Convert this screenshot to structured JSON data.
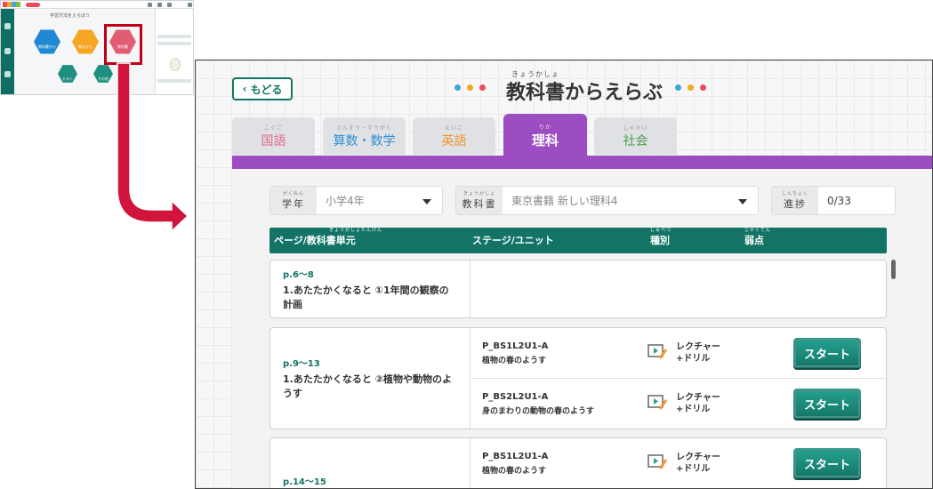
{
  "thumbnail": {
    "title": "学習方法をえらぼう",
    "hexes": [
      {
        "label": "教科書から",
        "color": "#1e88d4"
      },
      {
        "label": "単元から",
        "color": "#f5a623"
      },
      {
        "label": "教科書",
        "color": "#e25c74"
      },
      {
        "label": "テスト",
        "color": "#1f8f80"
      },
      {
        "label": "その他",
        "color": "#1f8f80"
      }
    ]
  },
  "colors": {
    "accent": "#137466",
    "science": "#9b4dc1",
    "arrow": "#d0143c"
  },
  "header": {
    "back_label": "もどる",
    "title_ruby": "きょうかしょ",
    "title": "教科書からえらぶ"
  },
  "tabs": [
    {
      "ruby": "こくご",
      "label": "国語",
      "color": "#e56a87",
      "active": false
    },
    {
      "ruby": "さんすう・すうがく",
      "label": "算数・数学",
      "color": "#2e8fd3",
      "active": false
    },
    {
      "ruby": "えいご",
      "label": "英語",
      "color": "#f0962b",
      "active": false
    },
    {
      "ruby": "りか",
      "label": "理科",
      "color": "#ffffff",
      "active": true
    },
    {
      "ruby": "しゃかい",
      "label": "社会",
      "color": "#4aa04a",
      "active": false
    }
  ],
  "filters": {
    "grade": {
      "ruby": "がくねん",
      "label": "学年",
      "value": "小学4年"
    },
    "textbook": {
      "ruby": "きょうかしょ",
      "label": "教科書",
      "value": "東京書籍 新しい理科4"
    },
    "progress": {
      "ruby": "しんちょく",
      "label": "進捗",
      "value": "0/33"
    }
  },
  "table": {
    "headers": {
      "page_ruby": "きょうかしょたんげん",
      "page": "ページ/教科書単元",
      "stage": "ステージ/ユニット",
      "kind_ruby": "しゅべつ",
      "kind": "種別",
      "weak_ruby": "じゃくてん",
      "weak": "弱点"
    },
    "rows": [
      {
        "page": "p.6〜8",
        "unit": "1.あたたかくなると ①1年間の観察の計画",
        "stages": []
      },
      {
        "page": "p.9〜13",
        "unit": "1.あたたかくなると ②植物や動物のようす",
        "stages": [
          {
            "code": "P_BS1L2U1-A",
            "name": "植物の春のようす",
            "kind1": "レクチャー",
            "kind2": "+ドリル",
            "button": "スタート"
          },
          {
            "code": "P_BS2L2U1-A",
            "name": "身のまわりの動物の春のようす",
            "kind1": "レクチャー",
            "kind2": "+ドリル",
            "button": "スタート"
          }
        ]
      },
      {
        "page": "p.14〜15",
        "unit": "",
        "stages": [
          {
            "code": "P_BS1L2U1-A",
            "name": "植物の春のようす",
            "kind1": "レクチャー",
            "kind2": "+ドリル",
            "button": "スタート"
          }
        ]
      }
    ]
  }
}
